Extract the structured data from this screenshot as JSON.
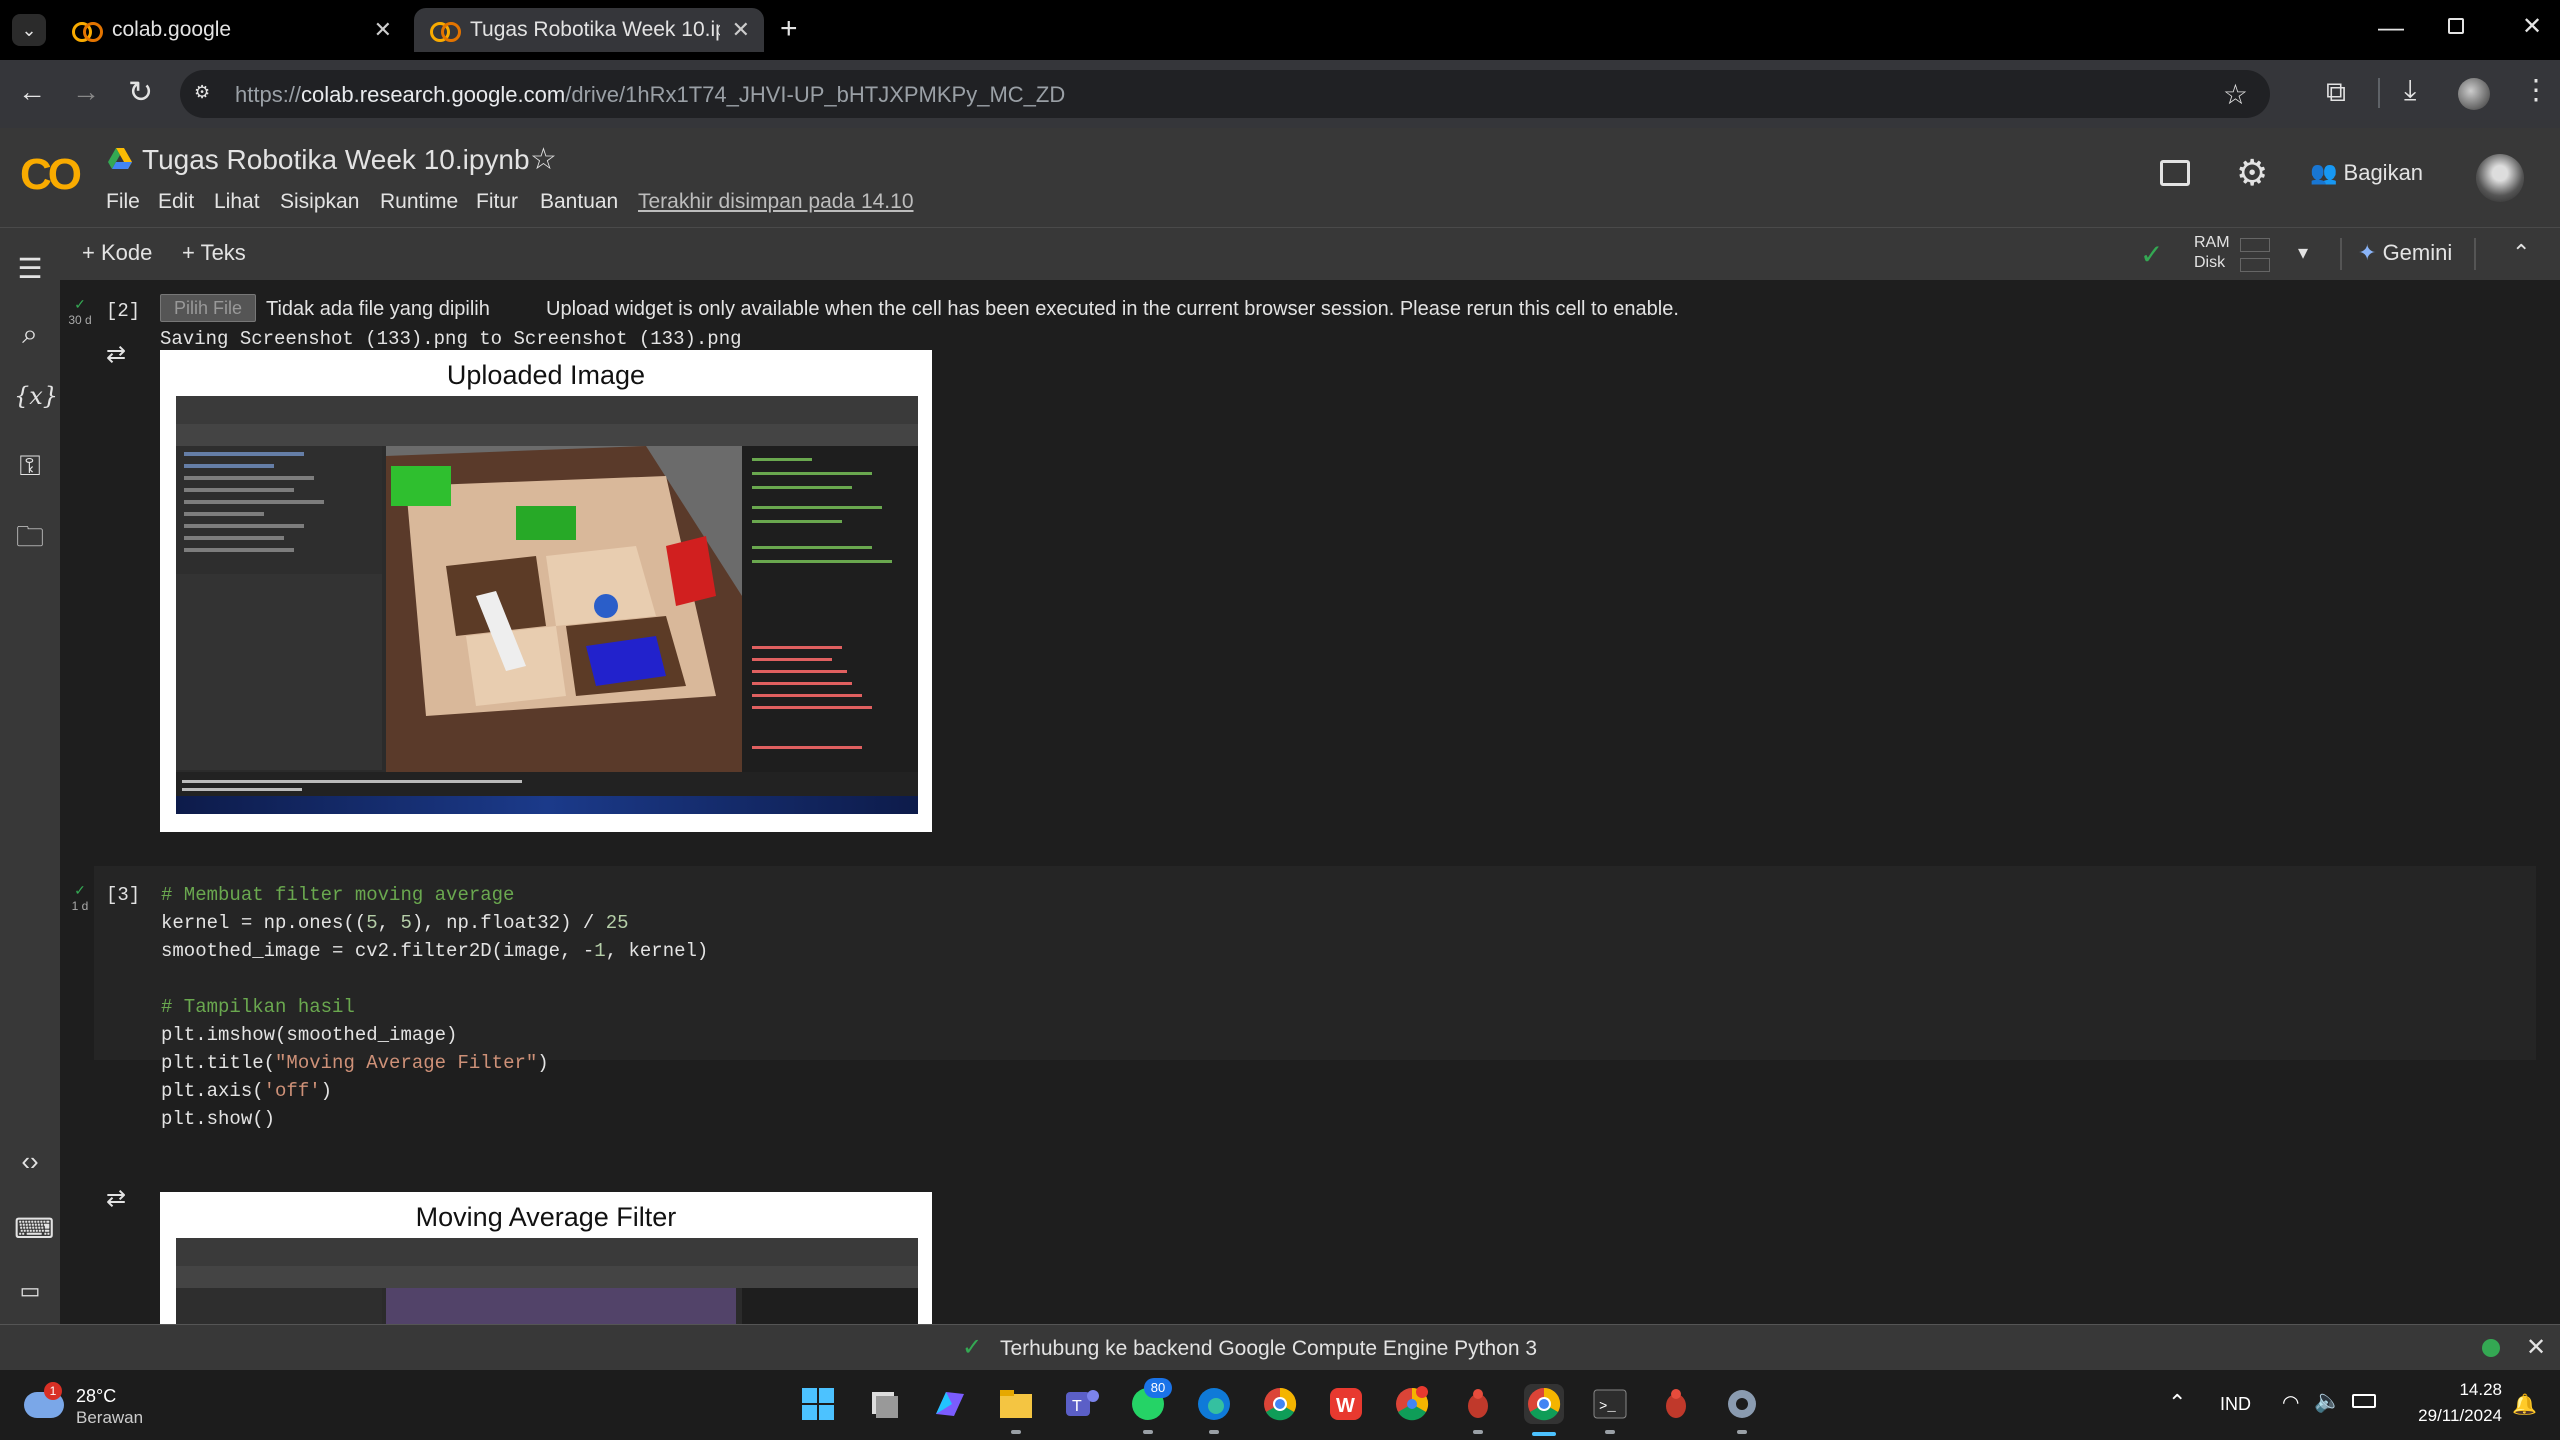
{
  "browser": {
    "tabs": [
      {
        "label": "colab.google",
        "active": false
      },
      {
        "label": "Tugas Robotika Week 10.ipynb",
        "active": true
      }
    ],
    "url_prefix": "https://",
    "url_host": "colab.research.google.com",
    "url_path": "/drive/1hRx1T74_JHVI-UP_bHTJXPMKPy_MC_ZD"
  },
  "colab": {
    "logo": "CO",
    "notebook_title": "Tugas Robotika Week 10.ipynb",
    "menu": [
      "File",
      "Edit",
      "Lihat",
      "Sisipkan",
      "Runtime",
      "Fitur",
      "Bantuan"
    ],
    "last_saved": "Terakhir disimpan pada 14.10",
    "share_label": "Bagikan",
    "add_code": "Kode",
    "add_text": "Teks",
    "ram_label": "RAM",
    "disk_label": "Disk",
    "gemini_label": "Gemini"
  },
  "cells": {
    "cell2": {
      "exec_count": "[2]",
      "time": "30 d",
      "file_button": "Pilih File",
      "no_file": "Tidak ada file yang dipilih",
      "upload_note": "Upload widget is only available when the cell has been executed in the current browser session. Please rerun this cell to enable.",
      "saving": "Saving Screenshot (133).png to Screenshot (133).png",
      "plot_title": "Uploaded Image"
    },
    "cell3": {
      "exec_count": "[3]",
      "time": "1 d",
      "code": [
        "# Membuat filter moving average",
        "kernel = np.ones((5, 5), np.float32) / 25",
        "smoothed_image = cv2.filter2D(image, -1, kernel)",
        "",
        "# Tampilkan hasil",
        "plt.imshow(smoothed_image)",
        "plt.title(\"Moving Average Filter\")",
        "plt.axis('off')",
        "plt.show()"
      ],
      "plot_title": "Moving Average Filter"
    }
  },
  "status": {
    "message": "Terhubung ke backend Google Compute Engine Python 3"
  },
  "taskbar": {
    "weather_temp": "28°C",
    "weather_desc": "Berawan",
    "weather_badge": "1",
    "whatsapp_badge": "80",
    "lang": "IND",
    "time": "14.28",
    "date": "29/11/2024"
  },
  "colors": {
    "accent_orange": "#f9ab00",
    "success_green": "#34a853",
    "code_bg": "#252525",
    "comment": "#6aa84f",
    "string": "#ce9178"
  }
}
